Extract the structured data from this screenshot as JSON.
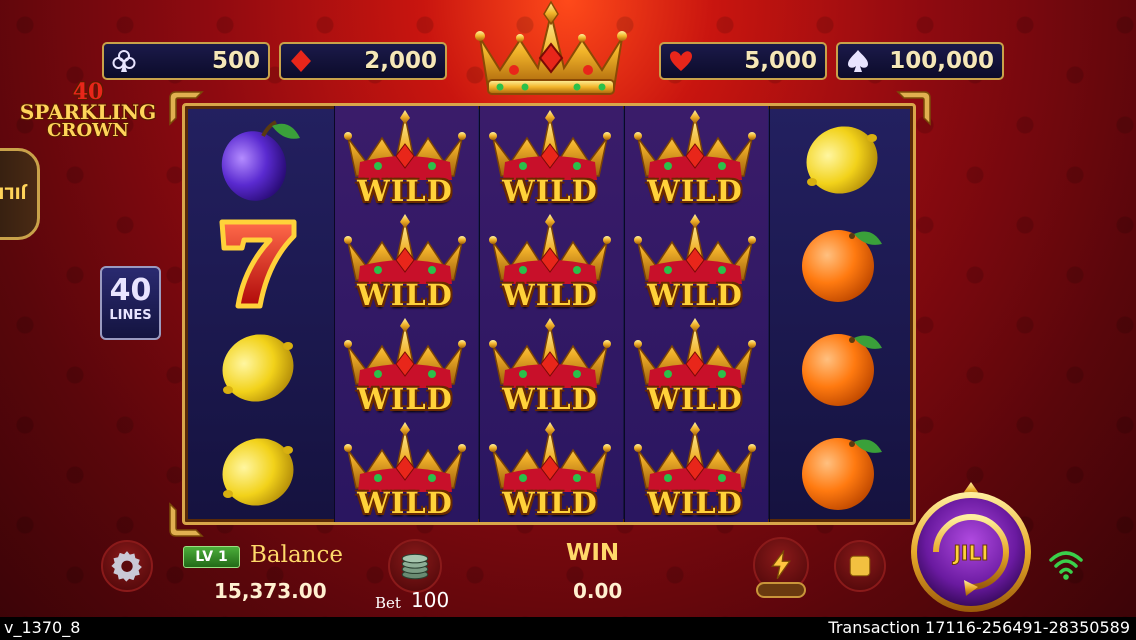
{
  "jackpots": [
    {
      "suit": "club-icon",
      "value": "500"
    },
    {
      "suit": "diamond-icon",
      "value": "2,000"
    },
    {
      "suit": "heart-icon",
      "value": "5,000"
    },
    {
      "suit": "spade-icon",
      "value": "100,000"
    }
  ],
  "logo": {
    "number": "40",
    "line1": "SPARKLING",
    "line2": "CROWN"
  },
  "provider_tab": "JILI",
  "lines": {
    "count": "40",
    "label": "LINES"
  },
  "reels": [
    [
      "plum",
      "seven",
      "lemon",
      "lemon"
    ],
    [
      "wild",
      "wild",
      "wild",
      "wild"
    ],
    [
      "wild",
      "wild",
      "wild",
      "wild"
    ],
    [
      "wild",
      "wild",
      "wild",
      "wild"
    ],
    [
      "lemon",
      "orange",
      "orange",
      "orange"
    ]
  ],
  "wild_label": "WILD",
  "player": {
    "level": "LV 1",
    "balance_label": "Balance",
    "balance": "15,373.00",
    "bet_label": "Bet",
    "bet": "100",
    "win_label": "WIN",
    "win": "0.00"
  },
  "spin_button_label": "JILI",
  "footer": {
    "version": "v_1370_8",
    "transaction": "Transaction 17116-256491-28350589"
  },
  "colors": {
    "accent_gold": "#ffd23a",
    "reel_bg": "#1b1850",
    "frame": "#d9a64a",
    "background_red": "#8e0a10"
  }
}
